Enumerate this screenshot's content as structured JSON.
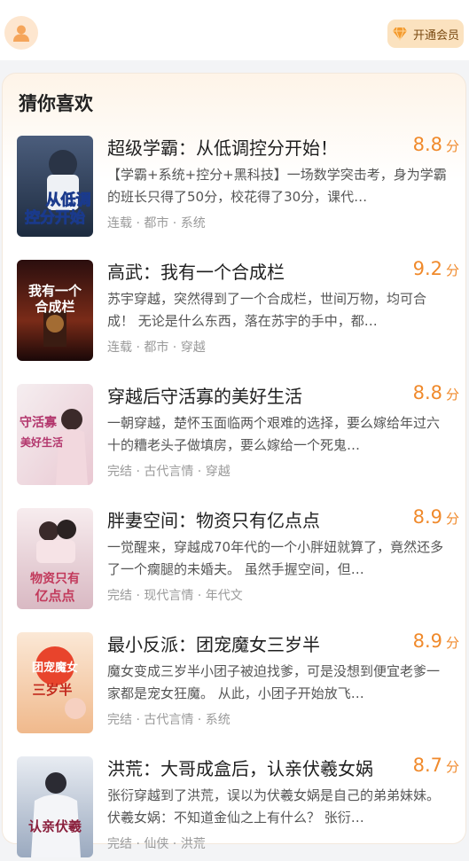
{
  "header": {
    "vip_label": "开通会员"
  },
  "section": {
    "title": "猜你喜欢"
  },
  "books": [
    {
      "title": "超级学霸：从低调控分开始！",
      "score": "8.8",
      "unit": "分",
      "desc": "【学霸+系统+控分+黑科技】一场数学突击考，身为学霸的班长只得了50分，校花得了30分，课代…",
      "tags": "连载 · 都市 · 系统",
      "cover_text": [
        "从低调",
        "控分开始"
      ],
      "cover_colors": [
        "#1d2b3f",
        "#4b5d7c"
      ]
    },
    {
      "title": "高武：我有一个合成栏",
      "score": "9.2",
      "unit": "分",
      "desc": "苏宇穿越，突然得到了一个合成栏，世间万物，均可合成！ 无论是什么东西，落在苏宇的手中，都…",
      "tags": "连载 · 都市 · 穿越",
      "cover_text": [
        "我有一个",
        "合成栏"
      ],
      "cover_colors": [
        "#2a0e0e",
        "#7a2b18"
      ]
    },
    {
      "title": "穿越后守活寡的美好生活",
      "score": "8.8",
      "unit": "分",
      "desc": "一朝穿越，楚怀玉面临两个艰难的选择，要么嫁给年过六十的糟老头子做填房，要么嫁给一个死鬼…",
      "tags": "完结 · 古代言情 · 穿越",
      "cover_text": [
        "守活寡",
        "美好生活"
      ],
      "cover_colors": [
        "#f5eef0",
        "#e9c8d2"
      ]
    },
    {
      "title": "胖妻空间：物资只有亿点点",
      "score": "8.9",
      "unit": "分",
      "desc": "一觉醒来，穿越成70年代的一个小胖妞就算了，竟然还多了一个瘸腿的未婚夫。 虽然手握空间，但…",
      "tags": "完结 · 现代言情 · 年代文",
      "cover_text": [
        "物资只有",
        "亿点点"
      ],
      "cover_colors": [
        "#f7ecee",
        "#d9b9c3"
      ]
    },
    {
      "title": "最小反派：团宠魔女三岁半",
      "score": "8.9",
      "unit": "分",
      "desc": "魔女变成三岁半小团子被迫找爹，可是没想到便宜老爹一家都是宠女狂魔。 从此，小团子开始放飞…",
      "tags": "完结 · 古代言情 · 系统",
      "cover_text": [
        "团宠魔女",
        "三岁半"
      ],
      "cover_colors": [
        "#fbe8d6",
        "#f0b98c"
      ]
    },
    {
      "title": "洪荒：大哥成盒后，认亲伏羲女娲",
      "score": "8.7",
      "unit": "分",
      "desc": "张衍穿越到了洪荒，误以为伏羲女娲是自己的弟弟妹妹。 伏羲女娲：不知道金仙之上有什么？ 张衍…",
      "tags": "完结 · 仙侠 · 洪荒",
      "cover_text": [
        "认亲伏羲"
      ],
      "cover_colors": [
        "#e8ecf2",
        "#9aa9bf"
      ]
    }
  ],
  "colors": {
    "score": "#f08a2c",
    "avatar_bg": "#fde6cf",
    "vip_bg": "#fbe2bf"
  },
  "icons": {
    "avatar": "user-icon",
    "vip": "diamond-icon"
  }
}
